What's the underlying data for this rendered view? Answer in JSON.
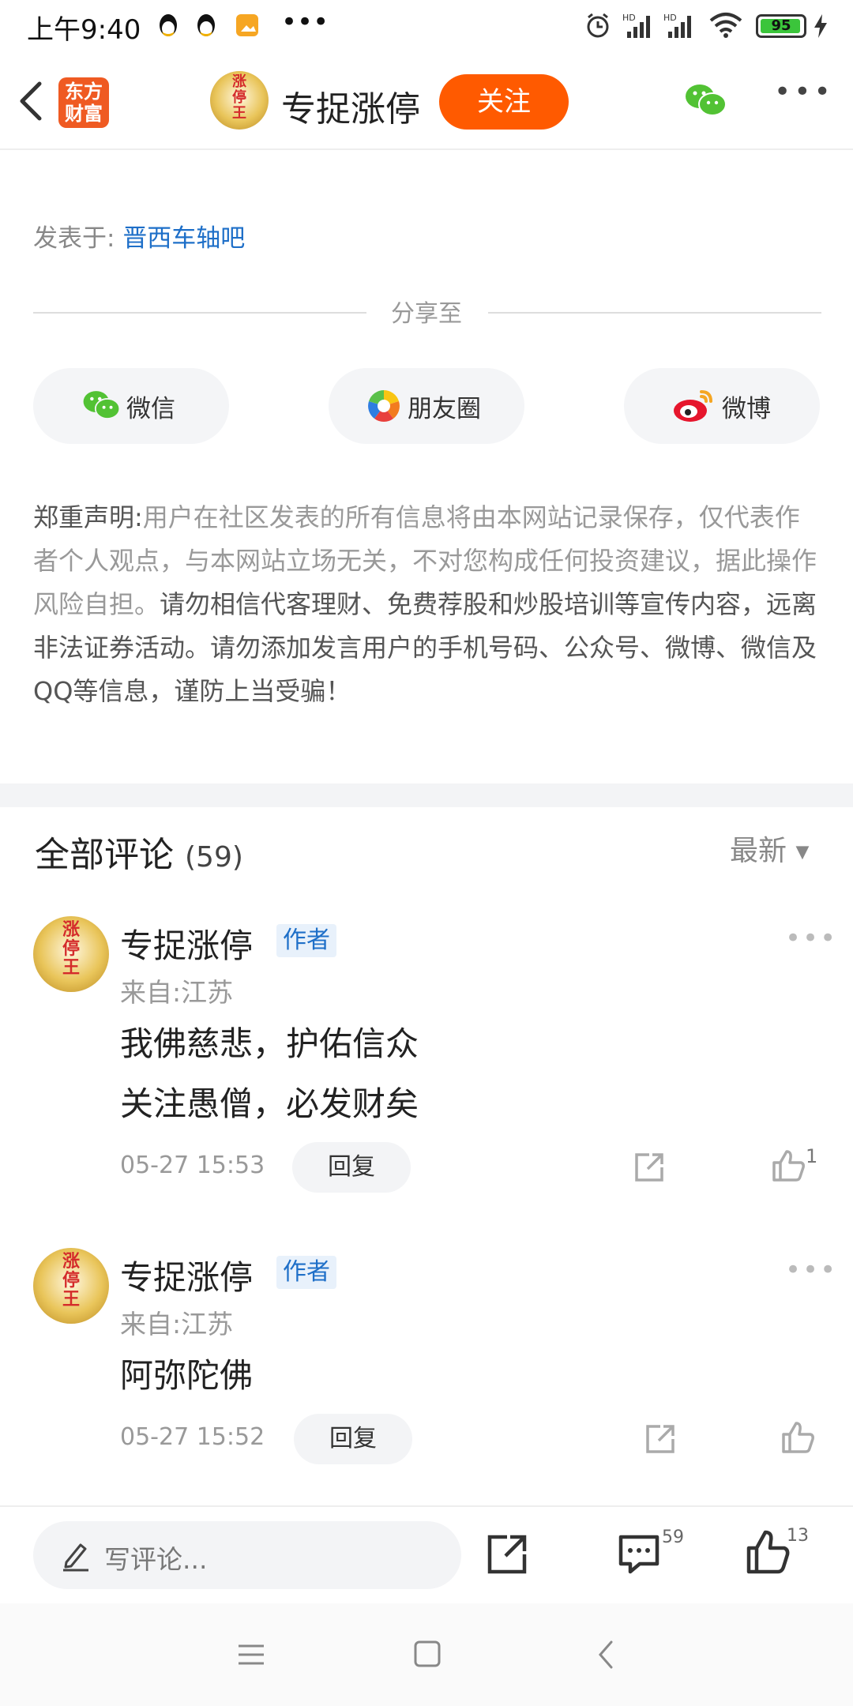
{
  "status_bar": {
    "time": "上午9:40",
    "battery": "95"
  },
  "header": {
    "app_logo": "东方\n财富",
    "avatar_text": "涨\n停\n王",
    "title": "专捉涨停",
    "follow_label": "关注"
  },
  "post": {
    "posted_prefix": "发表于:",
    "forum_name": "晋西车轴吧"
  },
  "share": {
    "heading": "分享至",
    "buttons": [
      {
        "label": "微信",
        "icon": "wechat-icon"
      },
      {
        "label": "朋友圈",
        "icon": "moments-icon"
      },
      {
        "label": "微博",
        "icon": "weibo-icon"
      }
    ]
  },
  "disclaimer": {
    "title": "郑重声明:",
    "part1": "用户在社区发表的所有信息将由本网站记录保存，仅代表作者个人观点，与本网站立场无关，不对您构成任何投资建议，据此操作风险自担。",
    "part2": "请勿相信代客理财、免费荐股和炒股培训等宣传内容，远离非法证券活动。请勿添加发言用户的手机号码、公众号、微博、微信及QQ等信息，谨防上当受骗！"
  },
  "comments": {
    "heading": "全部评论",
    "count": "(59)",
    "sort_label": "最新",
    "items": [
      {
        "author": "专捉涨停",
        "tag": "作者",
        "location": "来自:江苏",
        "lines": [
          "我佛慈悲，护佑信众",
          "关注愚僧，必发财矣"
        ],
        "time": "05-27 15:53",
        "reply_label": "回复",
        "likes": "1"
      },
      {
        "author": "专捉涨停",
        "tag": "作者",
        "location": "来自:江苏",
        "lines": [
          "阿弥陀佛"
        ],
        "time": "05-27 15:52",
        "reply_label": "回复",
        "likes": ""
      }
    ]
  },
  "bottom_bar": {
    "comment_placeholder": "写评论...",
    "comment_count": "59",
    "like_count": "13"
  },
  "colors": {
    "accent_orange": "#ff5a00",
    "link_blue": "#1e6fc8",
    "wechat_green": "#52c234"
  }
}
